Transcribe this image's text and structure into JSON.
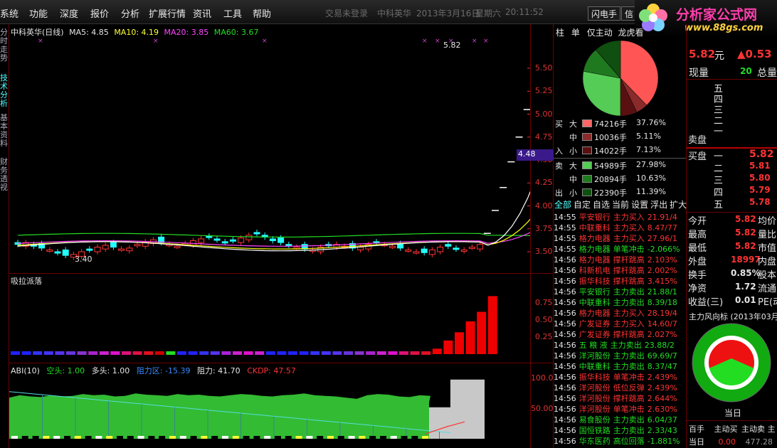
{
  "menu": {
    "items": [
      "系统",
      "功能",
      "深度",
      "报价",
      "分析",
      "扩展行情",
      "资讯",
      "工具",
      "帮助"
    ]
  },
  "header": {
    "login_status": "交易未登录",
    "stock_name": "中科英华",
    "date": "2013年3月16日",
    "weekday": "星期六",
    "time": "20:11:52"
  },
  "toolbar": {
    "flash_button": "闪电手",
    "info_button": "信"
  },
  "logo": {
    "text": "分析家公式网",
    "url": "www.88gs.com"
  },
  "side_tabs": [
    "分时走势",
    "技术分析",
    "基本资料",
    "财务透视"
  ],
  "main_chart": {
    "title": "中科英华(日线)",
    "ma5": "MA5: 4.85",
    "ma10": "MA10: 4.19",
    "ma20": "MA20: 3.85",
    "ma60": "MA60: 3.67",
    "high_label": "5.82",
    "low_label": "3.40",
    "y_ticks": [
      "5.50",
      "5.25",
      "5.00",
      "4.75",
      "4.50",
      "4.25",
      "4.00",
      "3.75",
      "3.50"
    ],
    "cursor_price": "4.48",
    "colors": {
      "ma5": "#ffffff",
      "ma10": "#ffff00",
      "ma20": "#ff44ff",
      "ma60": "#22dd22",
      "up": "#ff3333",
      "down": "#22ffff"
    }
  },
  "indicator1": {
    "title": "吸拉派落",
    "y_ticks": [
      "0.75",
      "0.50",
      "0.25"
    ]
  },
  "indicator2": {
    "title": "ABI(10)",
    "kong": "空头: 1.00",
    "duo": "多头: 1.00",
    "zuli_qu": "阻力区: -15.39",
    "zuli": "阻力: 41.70",
    "ckdp": "CKDP: 47.57",
    "y_ticks": [
      "100.0",
      "50.00"
    ]
  },
  "tabs_mid": [
    "柱",
    "单",
    "仅主动",
    "龙虎看"
  ],
  "pie_chart": {
    "slices": [
      {
        "name": "买大",
        "value": 37.76,
        "color": "#ff5555"
      },
      {
        "name": "买中",
        "value": 5.11,
        "color": "#8b2a2a"
      },
      {
        "name": "买小",
        "value": 7.13,
        "color": "#5a1010"
      },
      {
        "name": "卖大",
        "value": 27.98,
        "color": "#55cc55"
      },
      {
        "name": "卖中",
        "value": 10.63,
        "color": "#1f7a1f"
      },
      {
        "name": "卖小",
        "value": 11.39,
        "color": "#0f4f0f"
      }
    ]
  },
  "flow": [
    {
      "side": "买",
      "size": "大",
      "vol": "74216手",
      "pct": "37.76%",
      "color": "#ff6666"
    },
    {
      "side": "",
      "size": "中",
      "vol": "10036手",
      "pct": "5.11%",
      "color": "#8b2a2a"
    },
    {
      "side": "入",
      "size": "小",
      "vol": "14022手",
      "pct": "7.13%",
      "color": "#5a1010"
    },
    {
      "side": "卖",
      "size": "大",
      "vol": "54989手",
      "pct": "27.98%",
      "color": "#55cc55"
    },
    {
      "side": "",
      "size": "中",
      "vol": "20894手",
      "pct": "10.63%",
      "color": "#1f7a1f"
    },
    {
      "side": "出",
      "size": "小",
      "vol": "22390手",
      "pct": "11.39%",
      "color": "#0f4f0f"
    }
  ],
  "filter_tabs": [
    "全部",
    "自定",
    "自选",
    "当前",
    "设置",
    "浮出",
    "扩大"
  ],
  "trades": [
    {
      "time": "14:55",
      "name": "平安银行",
      "type": "主力买入",
      "val": "21.91/4",
      "c": "r"
    },
    {
      "time": "14:55",
      "name": "中联重科",
      "type": "主力买入",
      "val": "8.47/77",
      "c": "r"
    },
    {
      "time": "14:55",
      "name": "格力电器",
      "type": "主力买入",
      "val": "27.96/1",
      "c": "r"
    },
    {
      "time": "14:55",
      "name": "格力电器",
      "type": "单笔冲击",
      "val": "-2.066%",
      "c": "g"
    },
    {
      "time": "14:56",
      "name": "格力电器",
      "type": "撑杆跳高",
      "val": "2.103%",
      "c": "r"
    },
    {
      "time": "14:56",
      "name": "科新机电",
      "type": "撑杆跳高",
      "val": "2.002%",
      "c": "r"
    },
    {
      "time": "14:56",
      "name": "振华科技",
      "type": "撑杆跳高",
      "val": "3.415%",
      "c": "r"
    },
    {
      "time": "14:56",
      "name": "平安银行",
      "type": "主力卖出",
      "val": "21.88/1",
      "c": "g"
    },
    {
      "time": "14:56",
      "name": "中联重科",
      "type": "主力卖出",
      "val": "8.39/18",
      "c": "g"
    },
    {
      "time": "14:56",
      "name": "格力电器",
      "type": "主力买入",
      "val": "28.19/4",
      "c": "r"
    },
    {
      "time": "14:56",
      "name": "广发证券",
      "type": "主力买入",
      "val": "14.60/7",
      "c": "r"
    },
    {
      "time": "14:56",
      "name": "广发证券",
      "type": "撑杆跳高",
      "val": "2.027%",
      "c": "r"
    },
    {
      "time": "14:56",
      "name": "五 粮 液",
      "type": "主力卖出",
      "val": "23.88/2",
      "c": "g"
    },
    {
      "time": "14:56",
      "name": "洋河股份",
      "type": "主力卖出",
      "val": "69.69/7",
      "c": "g"
    },
    {
      "time": "14:56",
      "name": "中联重科",
      "type": "主力卖出",
      "val": "8.37/47",
      "c": "g"
    },
    {
      "time": "14:56",
      "name": "振华科技",
      "type": "单笔冲击",
      "val": "2.439%",
      "c": "r"
    },
    {
      "time": "14:56",
      "name": "洋河股份",
      "type": "低位反弹",
      "val": "2.439%",
      "c": "r"
    },
    {
      "time": "14:56",
      "name": "洋河股份",
      "type": "撑杆跳高",
      "val": "2.644%",
      "c": "r"
    },
    {
      "time": "14:56",
      "name": "洋河股份",
      "type": "单笔冲击",
      "val": "2.630%",
      "c": "r"
    },
    {
      "time": "14:56",
      "name": "易食股份",
      "type": "主力卖出",
      "val": "6.04/37",
      "c": "g"
    },
    {
      "time": "14:56",
      "name": "国恒铁路",
      "type": "主力卖出",
      "val": "2.33/43",
      "c": "g"
    },
    {
      "time": "14:56",
      "name": "华东医药",
      "type": "高位回落",
      "val": "-1.881%",
      "c": "g"
    }
  ],
  "quote": {
    "price": "5.82",
    "price_unit": "元",
    "change": "▲0.53",
    "xianliang_label": "现量",
    "xianliang": "20",
    "zongliang_label": "总量",
    "sell_labels": [
      "五",
      "四",
      "三",
      "二",
      "一"
    ],
    "sell_title": "卖盘",
    "buy_title": "买盘",
    "buy_labels": [
      "一",
      "二",
      "三",
      "四",
      "五"
    ],
    "buy_prices": [
      "5.82",
      "5.81",
      "5.80",
      "5.79",
      "5.78"
    ],
    "stats": [
      {
        "l": "今开",
        "v": "5.82",
        "c": "r",
        "l2": "均价"
      },
      {
        "l": "最高",
        "v": "5.82",
        "c": "r",
        "l2": "量比"
      },
      {
        "l": "最低",
        "v": "5.82",
        "c": "r",
        "l2": "市值"
      },
      {
        "l": "外盘",
        "v": "18997",
        "c": "r",
        "l2": "内盘"
      },
      {
        "l": "换手",
        "v": "0.85%",
        "c": "w",
        "l2": "股本"
      },
      {
        "l": "净资",
        "v": "1.72",
        "c": "w",
        "l2": "流通"
      },
      {
        "l": "收益(三)",
        "v": "0.01",
        "c": "w",
        "l2": "PE(动)"
      }
    ],
    "wind_title": "主力风向标 (2013年03月",
    "today_label": "当日",
    "bottom_headers": [
      "百手",
      "主动买",
      "主动卖",
      "主"
    ],
    "bottom_row": {
      "label": "当日",
      "v1": "0.00",
      "v2": "477.28"
    }
  }
}
